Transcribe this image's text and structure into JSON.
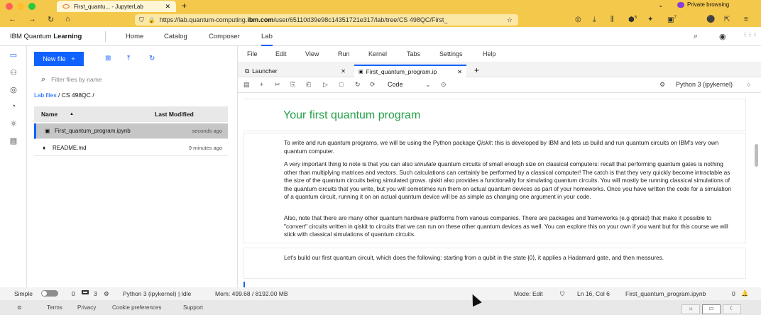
{
  "browser": {
    "tab_title": "First_quantu... - JupyterLab",
    "tab_close": "✕",
    "new_tab": "+",
    "chevron": "⌄",
    "private_label": "Private browsing",
    "url_prefix": "https://lab.quantum-computing.",
    "url_bold": "ibm.com",
    "url_suffix": "/user/65110d39e98c14351721e317/lab/tree/CS 498QC/First_",
    "icons": {
      "back": "←",
      "forward": "→",
      "reload": "↻",
      "home": "⌂",
      "shield": "⛉",
      "lock": "🔒",
      "star": "☆",
      "pocket": "◎",
      "download": "⤓",
      "library": "⫼",
      "ext1": "⬢",
      "ext2": "✦",
      "ext3": "▣",
      "account": "⚫",
      "share": "⇱",
      "menu": "≡"
    },
    "ext_badge_1": "6",
    "ext_badge_2": "7"
  },
  "ibm_header": {
    "brand_regular": "IBM Quantum ",
    "brand_bold": "Learning",
    "links": [
      "Home",
      "Catalog",
      "Composer",
      "Lab"
    ],
    "active_link": "Lab",
    "icons": {
      "search": "⌕",
      "user": "◉",
      "apps": "⋮⋮⋮"
    }
  },
  "left_rail": {
    "icons": [
      "folder-icon",
      "running-icon",
      "palette-icon",
      "gauge-icon",
      "extension-icon",
      "toc-icon"
    ],
    "glyphs": [
      "▭",
      "⚇",
      "◎",
      "◔",
      "⚛",
      "▤"
    ]
  },
  "file_browser": {
    "new_file_label": "New file",
    "new_file_plus": "+",
    "folder_glyph": "⊞",
    "upload_glyph": "⤒",
    "refresh_glyph": "↻",
    "search_glyph": "⌕",
    "search_placeholder": "Filter files by name",
    "breadcrumb_link": "Lab files",
    "breadcrumb_rest": " / CS 498QC /",
    "col_name": "Name",
    "col_sort": "▲",
    "col_modified": "Last Modified",
    "files": [
      {
        "icon": "▣",
        "name": "First_quantum_program.ipynb",
        "modified": "seconds ago"
      },
      {
        "icon": "♦",
        "name": "README.md",
        "modified": "9 minutes ago"
      }
    ]
  },
  "jupyter": {
    "menu": [
      "File",
      "Edit",
      "View",
      "Run",
      "Kernel",
      "Tabs",
      "Settings",
      "Help"
    ],
    "tabs": [
      {
        "icon": "⧉",
        "label": "Launcher",
        "close": "✕"
      },
      {
        "icon": "▣",
        "label": "First_quantum_program.ip",
        "close": "✕"
      }
    ],
    "add_tab": "+",
    "toolbar_glyphs": [
      "▤",
      "+",
      "✂",
      "⎘",
      "⎗",
      "▷",
      "□",
      "↻",
      "⟳"
    ],
    "cell_type": "Code",
    "cell_type_chevron": "⌄",
    "clock_glyph": "⊙",
    "kernel_glyph": "⚙",
    "kernel_label": "Python 3 (ipykernel)",
    "kernel_status": "○"
  },
  "notebook": {
    "heading": "Your first quantum program",
    "p1_a": "To write and run quantum programs, we will be using the Python package ",
    "p1_em": "Qiskit",
    "p1_b": ": this is developed by IBM and lets us build and run quantum circuits on IBM's very own quantum computer.",
    "p2_a": "A very important thing to note is that you can also ",
    "p2_em": "simulate",
    "p2_b": " quantum circuits of small enough size on classical computers: recall that performing quantum gates is nothing other than multiplying matrices and vectors. Such calculations can certainly be performed by a classical computer! The catch is that they very quickly become intractable as the size of the quantum circuits being simulated grows. qiskit also provides a functionality for simulating quantum circuits. You will mostly be running classical simulations of the quantum circuits that you write, but you will sometimes run them on actual quantum devices as part of your homeworks. Once you have written the code for a simulation of a quantum circuit, running it on an actual quantum device will be as simple as changing one argument in your code.",
    "p3": "Also, note that there are many other quantum hardware platforms from various companies. There are packages and frameworks (e.g qbraid) that make it possible to \"convert\" circuits written in qiskit to circuits that we can run on these other quantum devices as well. You can explore this on your own if you want but for this course we will stick with classical simulations of quantum circuits.",
    "p4": "Let's build our first quantum circuit, which does the following: starting from a qubit in the state |0⟩, it applies a Hadamard gate, and then measures."
  },
  "statusbar": {
    "simple_label": "Simple",
    "count_a": "0",
    "count_b": "3",
    "kernel_text": "Python 3 (ipykernel) | Idle",
    "mem_text": "Mem: 499.68 / 8192.00 MB",
    "mode_text": "Mode: Edit",
    "position_text": "Ln 16, Col 6",
    "file_text": "First_quantum_program.ipynb",
    "notif_count": "0",
    "bell": "🔔"
  },
  "footer": {
    "links": [
      "Terms",
      "Privacy",
      "Cookie preferences",
      "Support"
    ],
    "theme_glyphs": [
      "☼",
      "▭",
      "☾"
    ]
  }
}
